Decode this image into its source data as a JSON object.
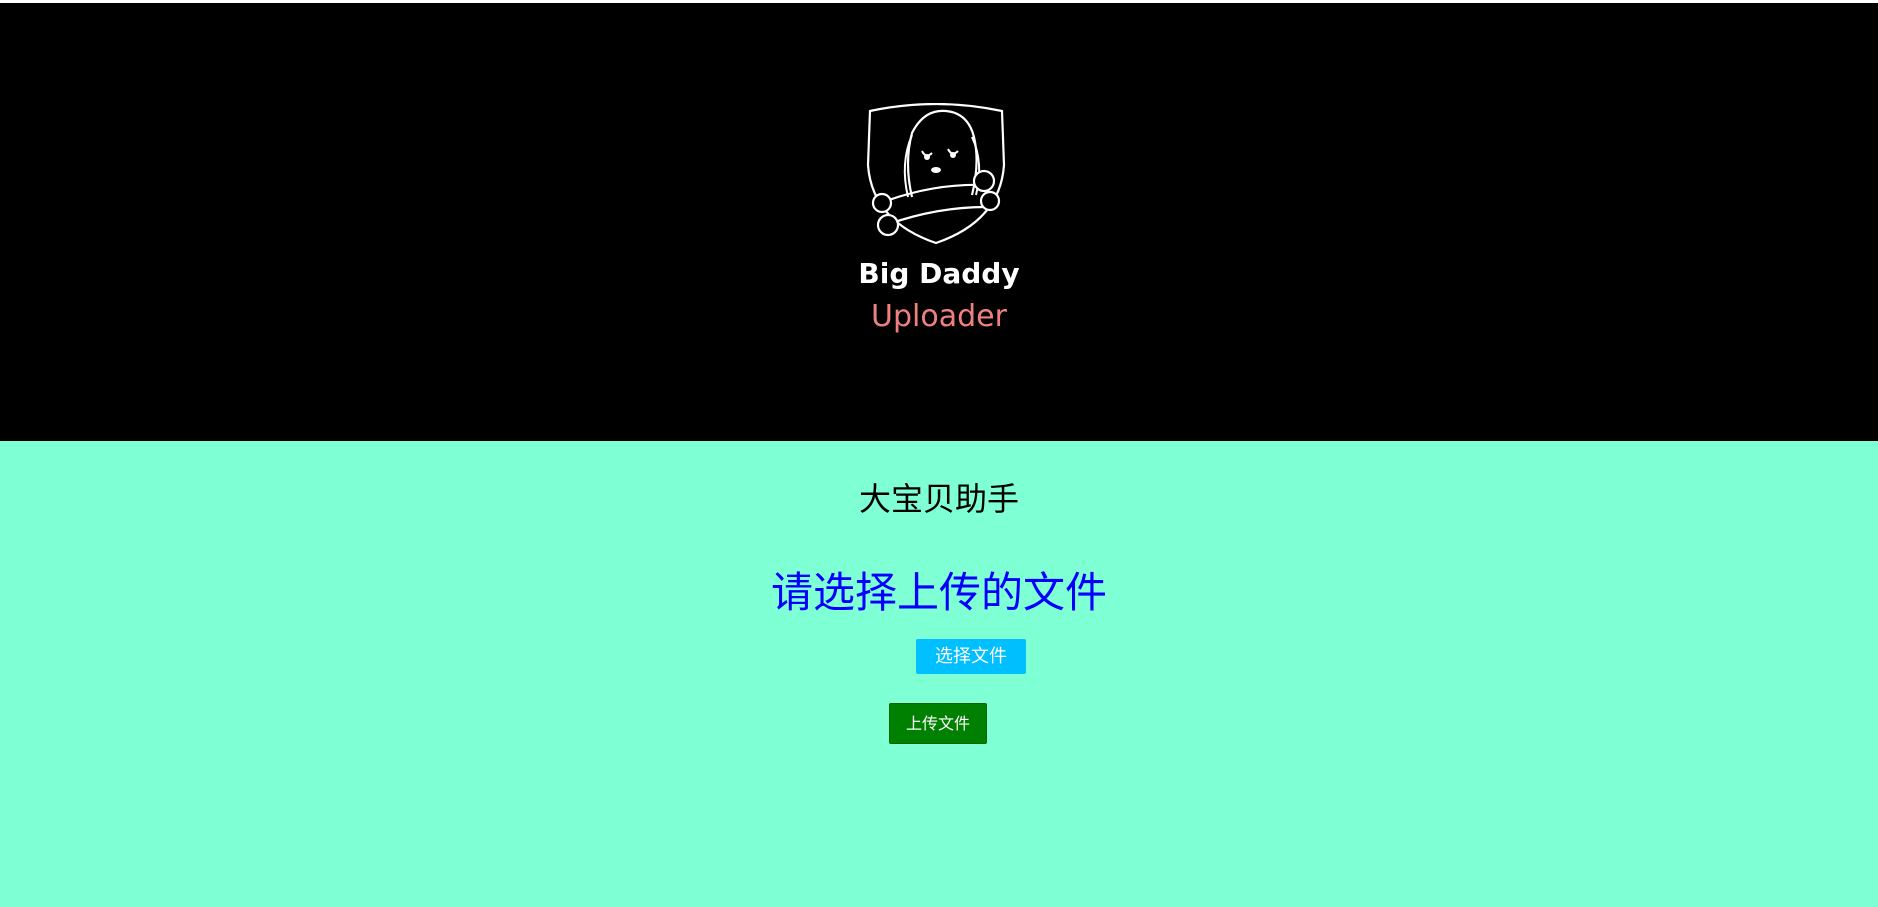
{
  "header": {
    "brand_title": "Big Daddy",
    "brand_subtitle": "Uploader",
    "logo_icon": "dog-with-bone-shield-icon"
  },
  "main": {
    "app_name": "大宝贝助手",
    "prompt": "请选择上传的文件",
    "choose_file_label": "选择文件",
    "upload_label": "上传文件"
  },
  "colors": {
    "header_bg": "#000000",
    "main_bg": "#7fffd4",
    "subtitle": "#f08080",
    "prompt": "#0000ff",
    "choose_button": "#00bfff",
    "upload_button": "#008000"
  }
}
